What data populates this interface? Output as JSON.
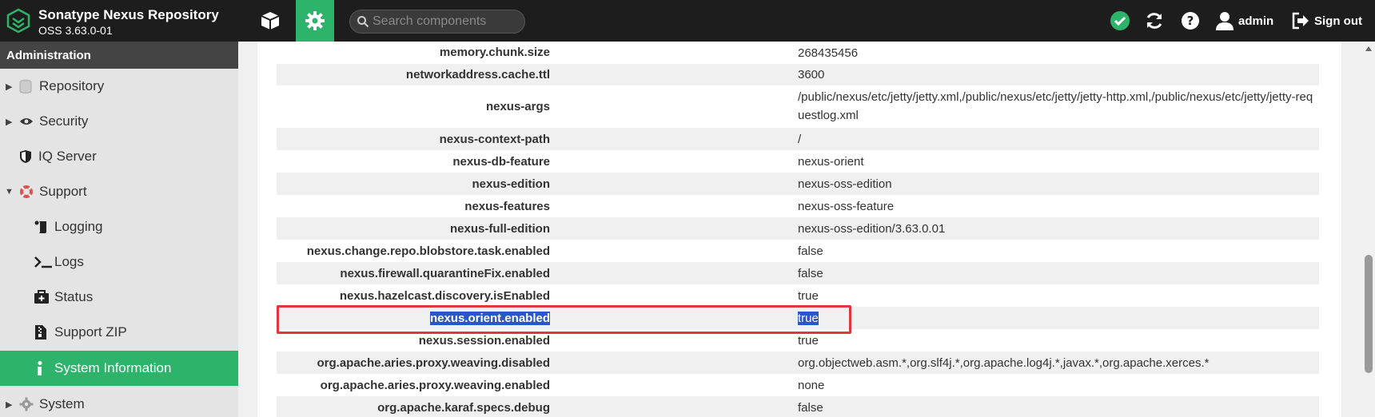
{
  "header": {
    "app_title": "Sonatype Nexus Repository",
    "version": "OSS 3.63.0-01",
    "search_placeholder": "Search components",
    "user_label": "admin",
    "signout_label": "Sign out"
  },
  "sidebar": {
    "section_title": "Administration",
    "items": [
      {
        "label": "Repository",
        "icon": "database-icon"
      },
      {
        "label": "Security",
        "icon": "eye-icon"
      },
      {
        "label": "IQ Server",
        "icon": "shield-icon"
      },
      {
        "label": "Support",
        "icon": "lifebuoy-icon"
      },
      {
        "label": "Logging",
        "icon": "scroll-icon"
      },
      {
        "label": "Logs",
        "icon": "terminal-icon"
      },
      {
        "label": "Status",
        "icon": "medkit-icon"
      },
      {
        "label": "Support ZIP",
        "icon": "zip-file-icon"
      },
      {
        "label": "System Information",
        "icon": "info-icon"
      },
      {
        "label": "System",
        "icon": "gear-icon"
      }
    ]
  },
  "properties": [
    {
      "key": "memory.chunk.size",
      "value": "268435456"
    },
    {
      "key": "networkaddress.cache.ttl",
      "value": "3600"
    },
    {
      "key": "nexus-args",
      "value": "/public/nexus/etc/jetty/jetty.xml,/public/nexus/etc/jetty/jetty-http.xml,/public/nexus/etc/jetty/jetty-requestlog.xml"
    },
    {
      "key": "nexus-context-path",
      "value": "/"
    },
    {
      "key": "nexus-db-feature",
      "value": "nexus-orient"
    },
    {
      "key": "nexus-edition",
      "value": "nexus-oss-edition"
    },
    {
      "key": "nexus-features",
      "value": "nexus-oss-feature"
    },
    {
      "key": "nexus-full-edition",
      "value": "nexus-oss-edition/3.63.0.01"
    },
    {
      "key": "nexus.change.repo.blobstore.task.enabled",
      "value": "false"
    },
    {
      "key": "nexus.firewall.quarantineFix.enabled",
      "value": "false"
    },
    {
      "key": "nexus.hazelcast.discovery.isEnabled",
      "value": "true"
    },
    {
      "key": "nexus.orient.enabled",
      "value": "true"
    },
    {
      "key": "nexus.session.enabled",
      "value": "true"
    },
    {
      "key": "org.apache.aries.proxy.weaving.disabled",
      "value": "org.objectweb.asm.*,org.slf4j.*,org.apache.log4j.*,javax.*,org.apache.xerces.*"
    },
    {
      "key": "org.apache.aries.proxy.weaving.enabled",
      "value": "none"
    },
    {
      "key": "org.apache.karaf.specs.debug",
      "value": "false"
    }
  ],
  "colors": {
    "accent": "#2db36a",
    "header_bg": "#1d1d1d",
    "highlight": "#e0363c",
    "selection": "#2957c7"
  }
}
